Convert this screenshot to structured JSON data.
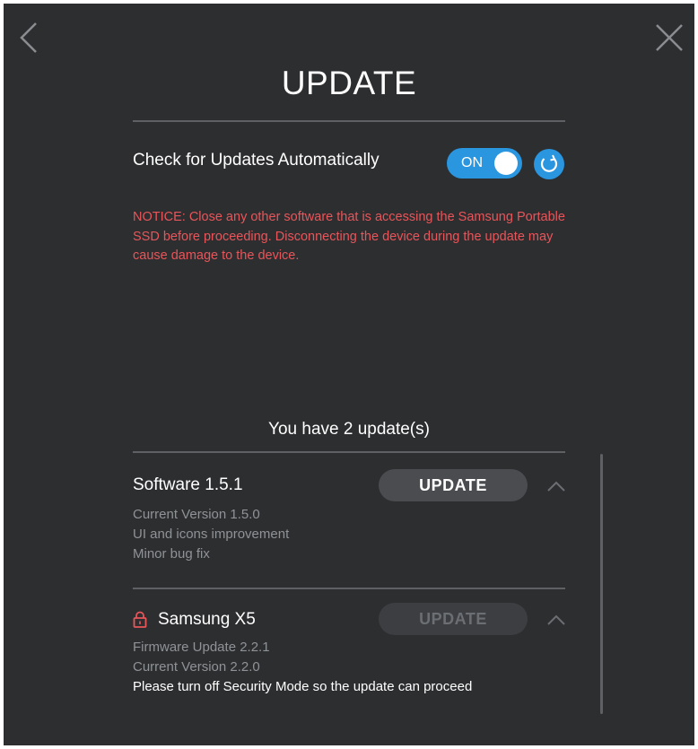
{
  "header": {
    "title": "UPDATE"
  },
  "auto_update": {
    "label": "Check for Updates Automatically",
    "toggle_state": "ON"
  },
  "notice": "NOTICE: Close any other software that is accessing the Samsung Portable SSD before proceeding. Disconnecting the device during the update may cause damage to the device.",
  "updates_count_text": "You have 2 update(s)",
  "updates": [
    {
      "name": "Software 1.5.1",
      "button_label": "UPDATE",
      "lines": [
        "Current Version 1.5.0",
        "UI and icons improvement",
        "Minor bug fix"
      ]
    },
    {
      "name": "Samsung X5",
      "button_label": "UPDATE",
      "lines": [
        "Firmware Update 2.2.1",
        "Current Version 2.2.0"
      ],
      "warning": "Please turn off Security Mode so the update can proceed"
    }
  ],
  "colors": {
    "background": "#2d2e30",
    "accent": "#2a96e0",
    "notice": "#e8555a",
    "lock": "#e8555a"
  },
  "icons": {
    "back": "chevron-left-icon",
    "close": "close-icon",
    "refresh": "refresh-icon",
    "collapse": "chevron-up-icon",
    "lock": "lock-icon"
  }
}
